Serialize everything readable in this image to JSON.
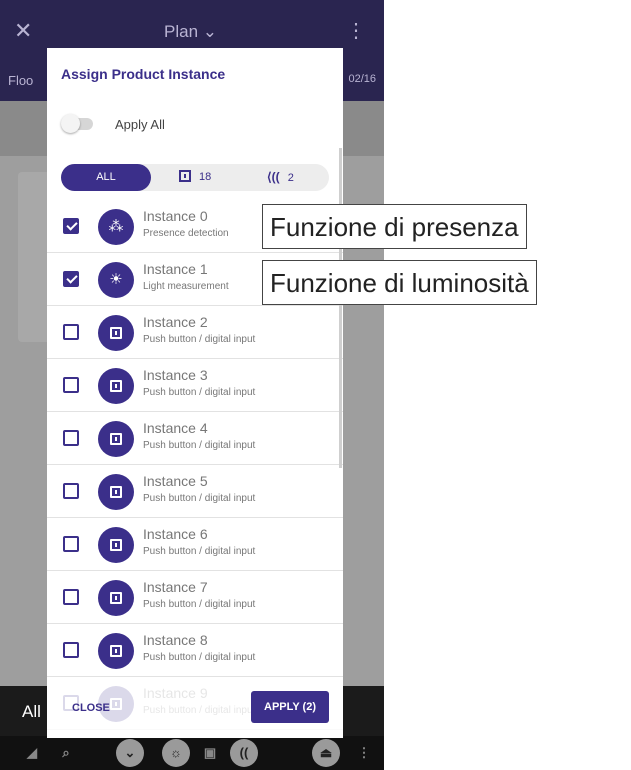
{
  "app": {
    "title": "Plan",
    "subbar_left": "Floo",
    "subbar_right": "02/16",
    "bottom_label": "All"
  },
  "dialog": {
    "title": "Assign Product Instance",
    "apply_all_label": "Apply All",
    "apply_all_on": false,
    "filter": {
      "all_label": "ALL",
      "push_count": "18",
      "presence_count": "2"
    },
    "instances": [
      {
        "name": "Instance 0",
        "desc": "Presence detection",
        "checked": true,
        "icon": "presence-sensor-icon"
      },
      {
        "name": "Instance 1",
        "desc": "Light measurement",
        "checked": true,
        "icon": "light-sensor-icon"
      },
      {
        "name": "Instance 2",
        "desc": "Push button / digital input",
        "checked": false,
        "icon": "push-button-icon"
      },
      {
        "name": "Instance 3",
        "desc": "Push button / digital input",
        "checked": false,
        "icon": "push-button-icon"
      },
      {
        "name": "Instance 4",
        "desc": "Push button / digital input",
        "checked": false,
        "icon": "push-button-icon"
      },
      {
        "name": "Instance 5",
        "desc": "Push button / digital input",
        "checked": false,
        "icon": "push-button-icon"
      },
      {
        "name": "Instance 6",
        "desc": "Push button / digital input",
        "checked": false,
        "icon": "push-button-icon"
      },
      {
        "name": "Instance 7",
        "desc": "Push button / digital input",
        "checked": false,
        "icon": "push-button-icon"
      },
      {
        "name": "Instance 8",
        "desc": "Push button / digital input",
        "checked": false,
        "icon": "push-button-icon"
      },
      {
        "name": "Instance 9",
        "desc": "Push button / digital input",
        "checked": false,
        "icon": "push-button-icon"
      }
    ],
    "close_label": "CLOSE",
    "apply_label": "APPLY (2)"
  },
  "annotations": {
    "presence": "Funzione di presenza",
    "luminosity": "Funzione di luminosità"
  },
  "colors": {
    "primary": "#3b2f8a",
    "header_dim": "#2a2550"
  }
}
